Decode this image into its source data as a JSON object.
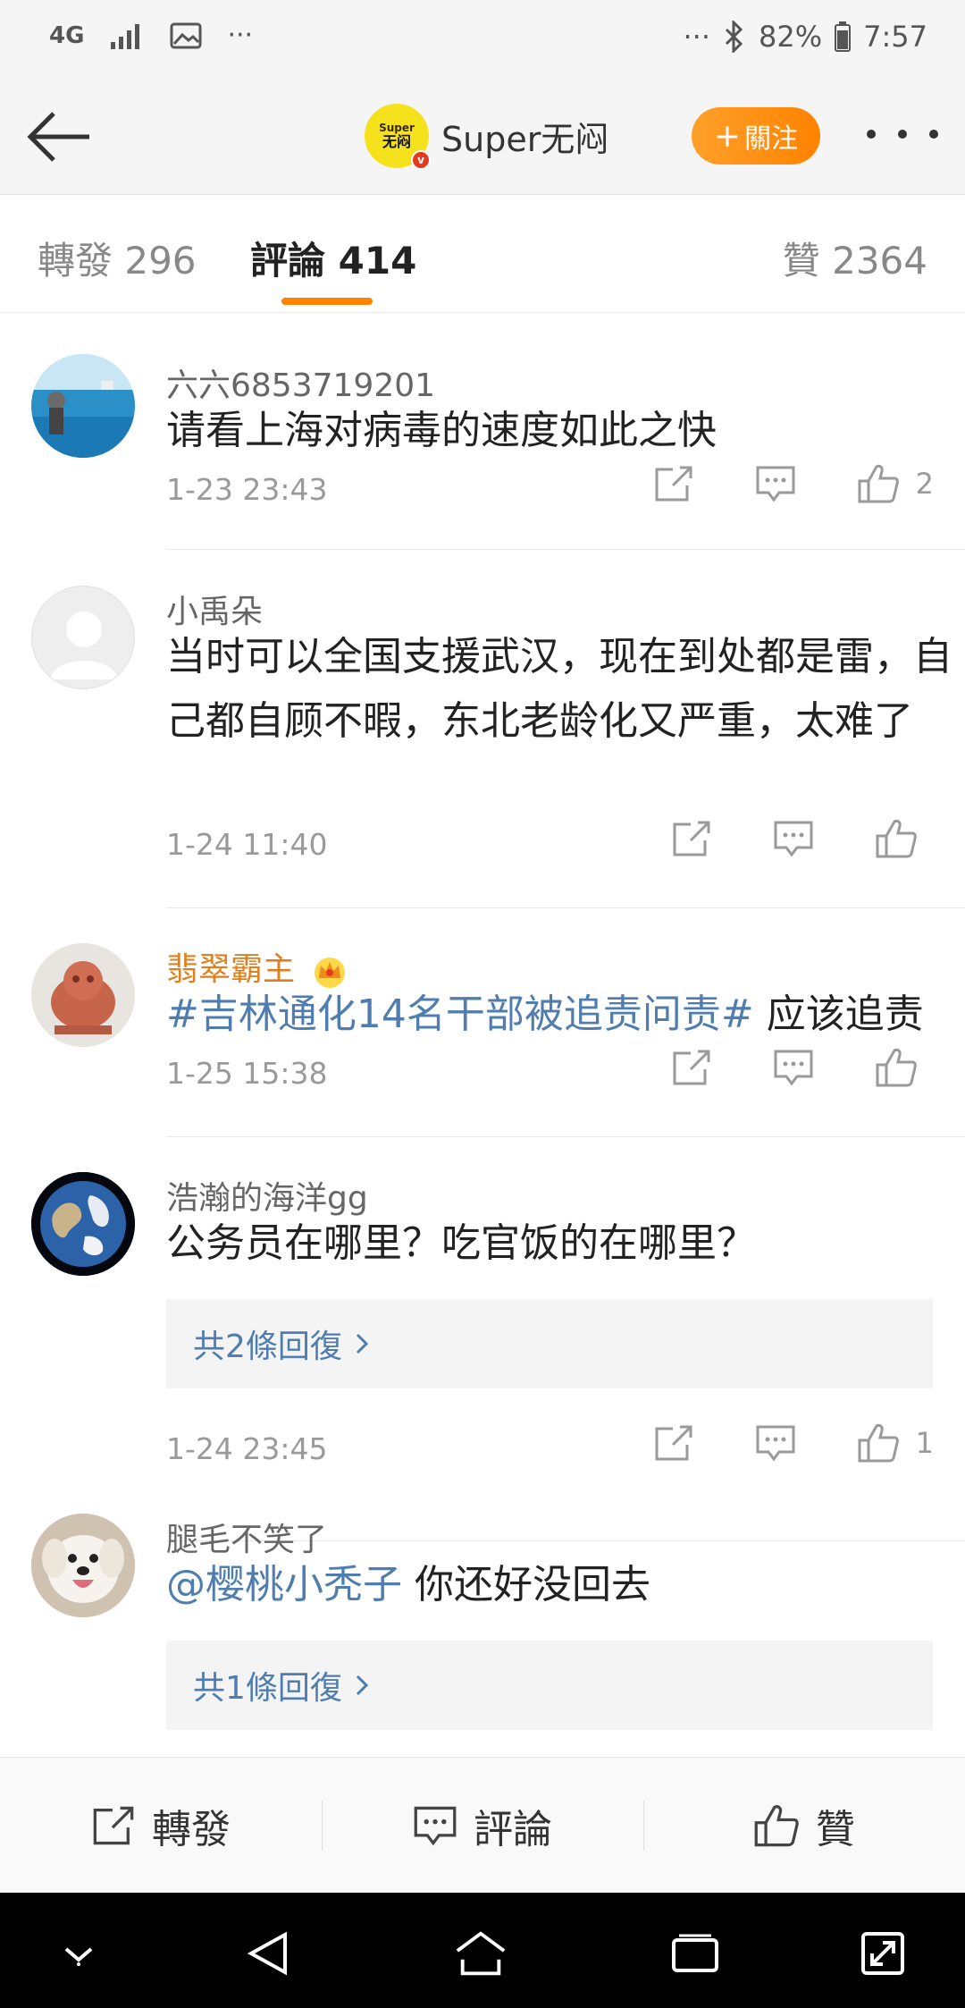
{
  "status_bar": {
    "network": "4G",
    "dots_left": "···",
    "dots_right": "···",
    "battery": "82%",
    "time": "7:57"
  },
  "nav": {
    "avatar_text_top": "Super",
    "avatar_text_bottom": "无闷",
    "account_name": "Super无闷",
    "follow_label": "關注",
    "follow_plus": "+"
  },
  "tabs": {
    "repost": "轉發 296",
    "comments": "評論 414",
    "likes": "贊 2364"
  },
  "comments": [
    {
      "name": "六六6853719201",
      "text": "请看上海对病毒的速度如此之快",
      "time": "1-23 23:43",
      "like_count": "2"
    },
    {
      "name": "小禹朵",
      "text": "当时可以全国支援武汉，现在到处都是雷，自己都自顾不暇，东北老龄化又严重，太难了",
      "time": "1-24 11:40",
      "like_count": ""
    },
    {
      "name": "翡翠霸主",
      "hashtag": "#吉林通化14名干部被追责问责#",
      "text": " 应该追责",
      "time": "1-25 15:38",
      "like_count": ""
    },
    {
      "name": "浩瀚的海洋gg",
      "text": "公务员在哪里？吃官饭的在哪里？",
      "reply_label": "共2條回復",
      "time": "1-24 23:45",
      "like_count": "1"
    },
    {
      "name": "腿毛不笑了",
      "mention": "@樱桃小秃子",
      "text": " 你还好没回去",
      "reply_label": "共1條回復"
    }
  ],
  "bottom_bar": {
    "repost": "轉發",
    "comment": "評論",
    "like": "贊"
  },
  "colors": {
    "accent": "#ff8200",
    "link": "#507daf",
    "gold_name": "#e07f1c"
  }
}
